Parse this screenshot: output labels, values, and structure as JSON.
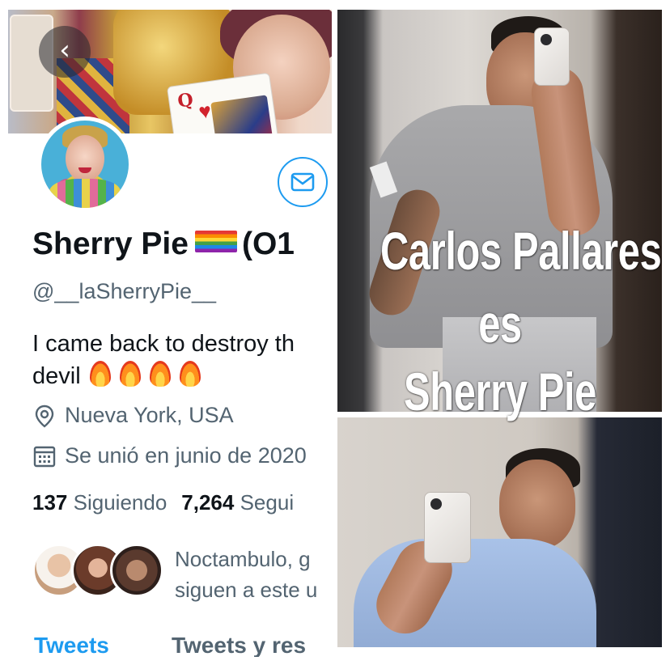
{
  "profile": {
    "back_label": "‹",
    "display_name": "Sherry Pie",
    "display_name_suffix": "(O1",
    "handle": "@__laSherryPie__",
    "bio_line1": "I came back to destroy th",
    "bio_line2": "devil",
    "location": "Nueva York, USA",
    "joined": "Se unió en junio de 2020",
    "following_count": "137",
    "following_label": "Siguiendo",
    "followers_count": "7,264",
    "followers_label": "Segui",
    "followed_by_line1": "Noctambulo, g",
    "followed_by_line2": "siguen a este u",
    "icons": {
      "back": "chevron-left-icon",
      "message": "envelope-icon",
      "location": "location-pin-icon",
      "joined": "calendar-icon",
      "flag": "rainbow-flag-icon",
      "fire": "fire-icon"
    },
    "colors": {
      "accent": "#1d9bf0",
      "text": "#0f1419",
      "muted": "#536471"
    }
  },
  "tabs": [
    {
      "label": "Tweets",
      "active": true
    },
    {
      "label": "Tweets y res",
      "active": false
    }
  ],
  "overlay": {
    "line1": "Carlos Pallares",
    "line2": "es",
    "line3": "Sherry Pie"
  }
}
